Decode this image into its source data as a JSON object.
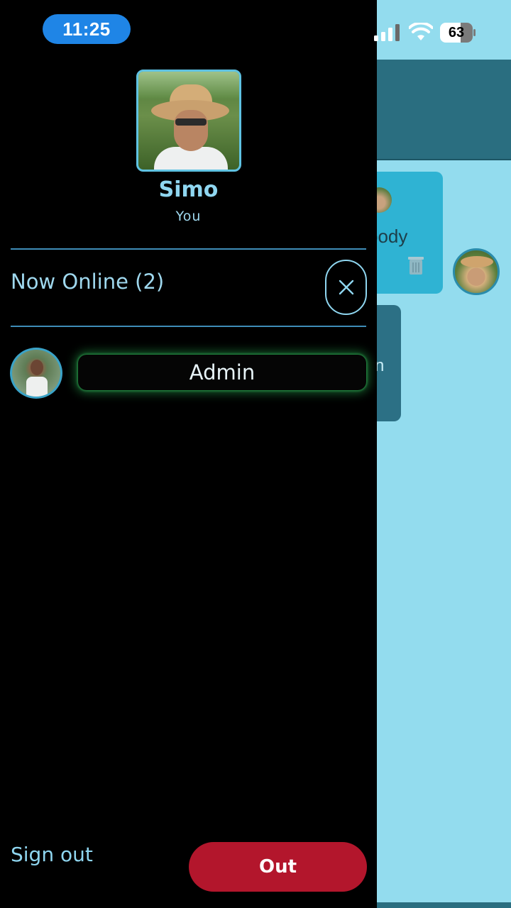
{
  "status_bar": {
    "time": "11:25",
    "battery_level": "63",
    "icons": [
      "signal-icon",
      "wifi-icon",
      "battery-icon"
    ]
  },
  "background": {
    "message_1_text": "body",
    "message_2_text": "n"
  },
  "drawer": {
    "profile": {
      "name": "Simo",
      "subtitle": "You"
    },
    "online_section": {
      "title": "Now Online (2)",
      "close_icon": "close-icon"
    },
    "online_users": [
      {
        "name": "Admin"
      }
    ],
    "footer": {
      "sign_out_label": "Sign out",
      "out_button_label": "Out"
    }
  },
  "colors": {
    "drawer_bg": "#000000",
    "accent": "#8fd6f0",
    "divider": "#3f8db8",
    "online_glow": "#28aa50",
    "out_button": "#b3162c",
    "time_pill": "#1f85e6",
    "chat_bg": "#93dcee",
    "chat_header": "#2a6e80"
  }
}
